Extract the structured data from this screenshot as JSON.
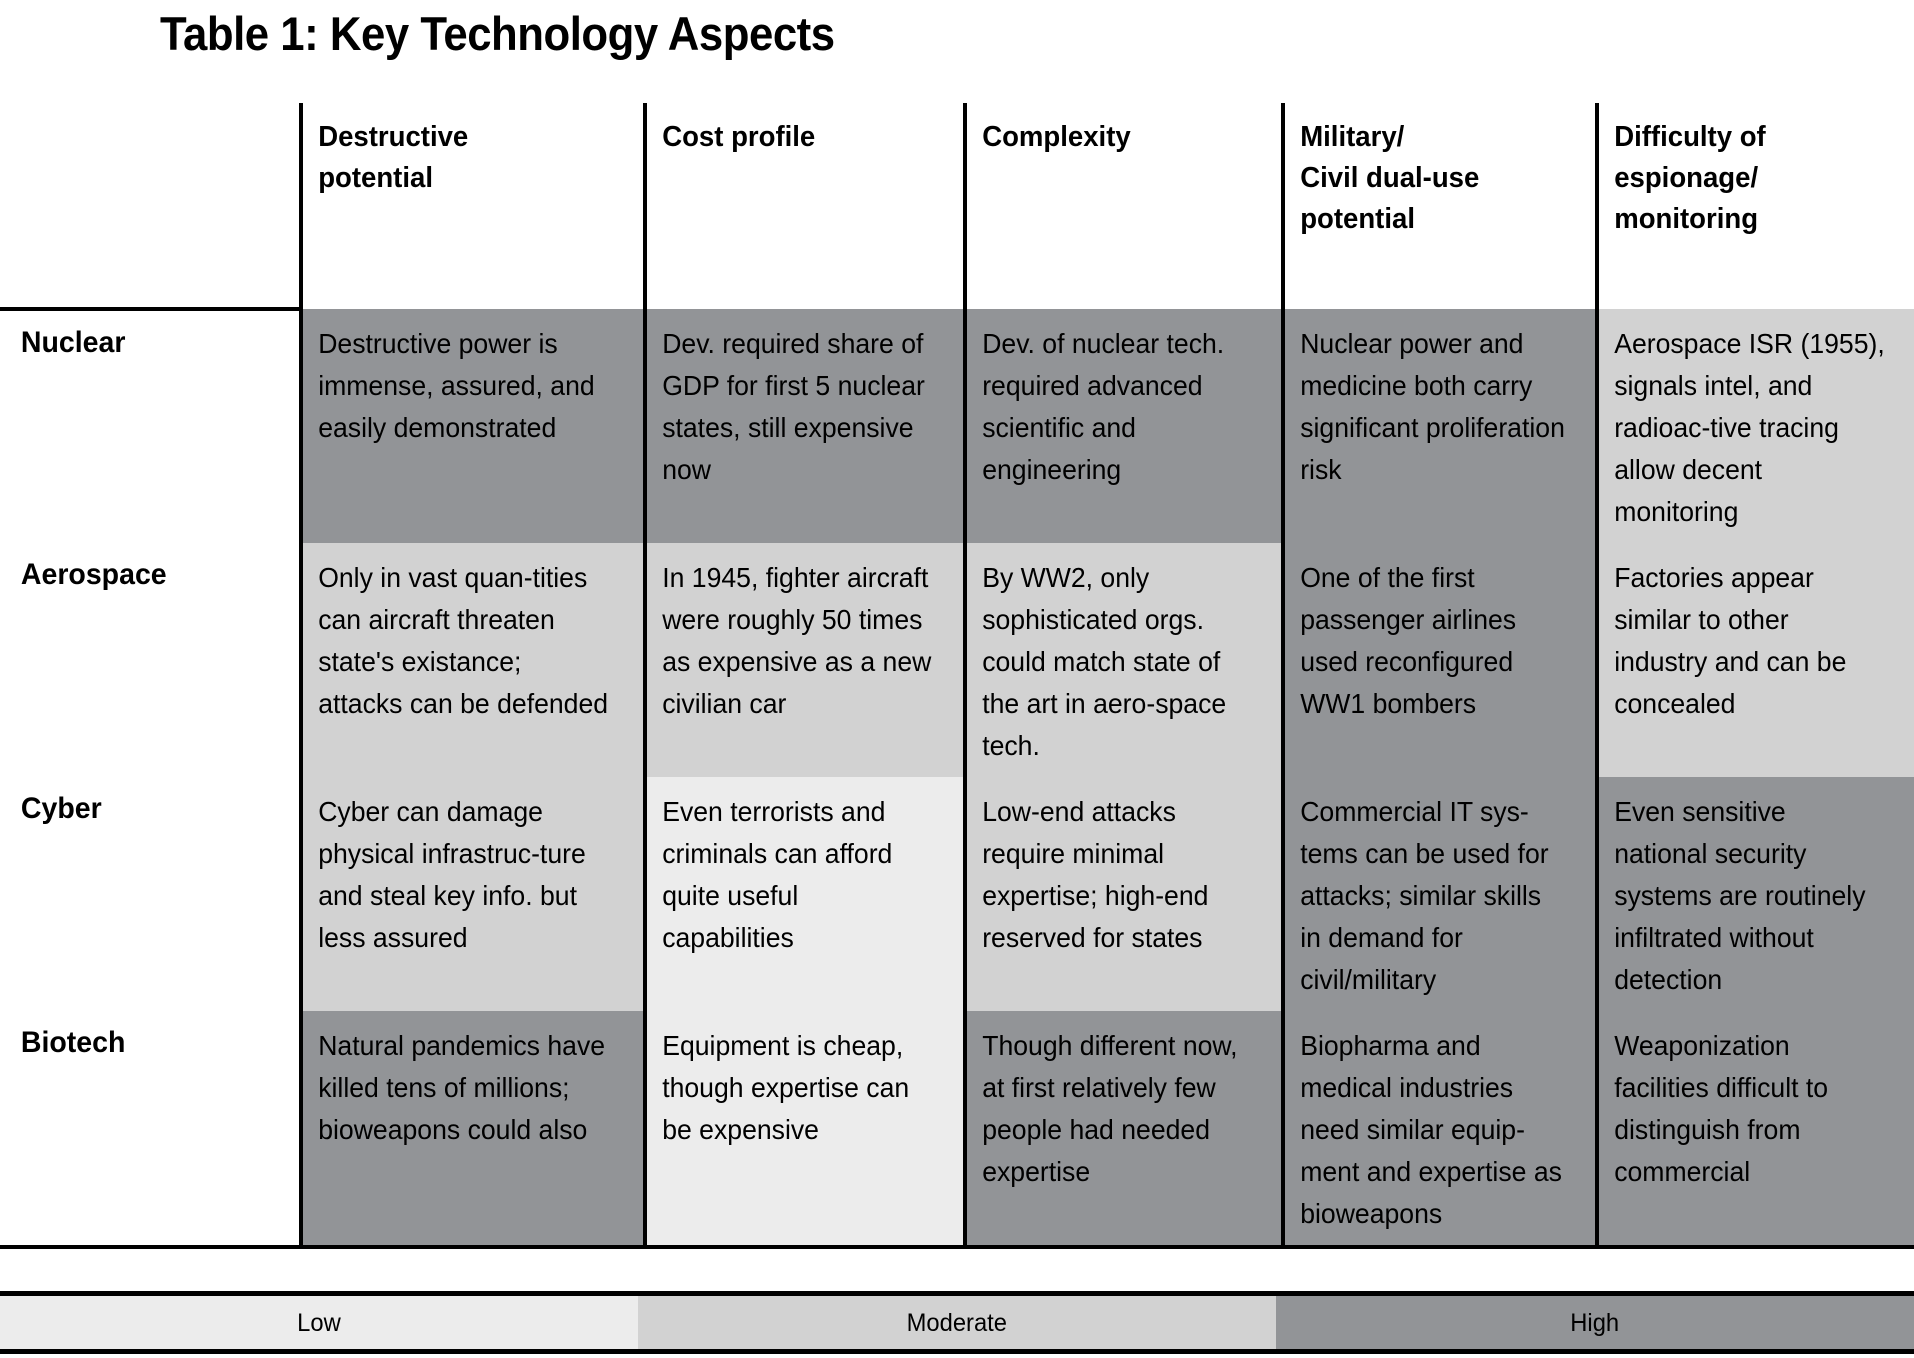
{
  "title": "Table 1: Key Technology Aspects",
  "table": {
    "columns": [
      {
        "id": "destructive_potential",
        "header": "Destructive\npotential"
      },
      {
        "id": "cost_profile",
        "header": "Cost profile"
      },
      {
        "id": "complexity",
        "header": "Complexity"
      },
      {
        "id": "dual_use",
        "header": "Military/\nCivil dual-use\npotential"
      },
      {
        "id": "espionage",
        "header": "Difficulty of\nespionage/\nmonitoring"
      }
    ],
    "rows": [
      {
        "label": "Nuclear",
        "cells": [
          {
            "text": "Destructive power is immense, assured, and easily demonstrated",
            "level": "high"
          },
          {
            "text": "Dev. required share of GDP for first 5 nuclear states, still expensive now",
            "level": "high"
          },
          {
            "text": "Dev. of nuclear tech. required advanced scientific and engineering",
            "level": "high"
          },
          {
            "text": "Nuclear power and medicine both carry significant proliferation risk",
            "level": "high"
          },
          {
            "text": "Aerospace ISR (1955), signals intel, and radioac-tive tracing allow decent monitoring",
            "level": "moderate"
          }
        ]
      },
      {
        "label": "Aerospace",
        "cells": [
          {
            "text": "Only in vast quan-tities can aircraft threaten state's existance; attacks can be defended",
            "level": "moderate"
          },
          {
            "text": "In 1945, fighter aircraft were roughly 50 times as expensive as a new civilian car",
            "level": "moderate"
          },
          {
            "text": "By WW2, only sophisticated orgs. could match state of the art in aero-space tech.",
            "level": "moderate"
          },
          {
            "text": "One of the first passenger airlines used reconfigured WW1 bombers",
            "level": "high"
          },
          {
            "text": "Factories appear similar to other industry and can be concealed",
            "level": "moderate"
          }
        ]
      },
      {
        "label": "Cyber",
        "cells": [
          {
            "text": "Cyber can damage physical infrastruc-ture and steal key info. but less assured",
            "level": "moderate"
          },
          {
            "text": "Even terrorists and criminals can afford quite useful capabilities",
            "level": "low"
          },
          {
            "text": "Low-end attacks require minimal expertise; high-end reserved for states",
            "level": "moderate"
          },
          {
            "text": "Commercial IT sys-tems can be used for attacks; similar skills in demand for civil/military",
            "level": "high"
          },
          {
            "text": "Even sensitive national security systems are routinely infiltrated without detection",
            "level": "high"
          }
        ]
      },
      {
        "label": "Biotech",
        "cells": [
          {
            "text": "Natural pandemics have killed tens of millions; bioweapons could also",
            "level": "high"
          },
          {
            "text": "Equipment is cheap, though expertise can be expensive",
            "level": "low"
          },
          {
            "text": "Though different now, at first relatively few people had needed expertise",
            "level": "high"
          },
          {
            "text": "Biopharma and medical industries need similar equip-ment and expertise as bioweapons",
            "level": "high"
          },
          {
            "text": "Weaponization facilities difficult to distinguish from commercial",
            "level": "high"
          }
        ]
      }
    ]
  },
  "legend": {
    "items": [
      {
        "label": "Low",
        "level": "low",
        "color": "#ececec"
      },
      {
        "label": "Moderate",
        "level": "moderate",
        "color": "#d2d2d2"
      },
      {
        "label": "High",
        "level": "high",
        "color": "#929497"
      }
    ]
  },
  "colors": {
    "low": "#ececec",
    "moderate": "#d2d2d2",
    "high": "#929497",
    "border": "#000000",
    "background": "#ffffff"
  }
}
